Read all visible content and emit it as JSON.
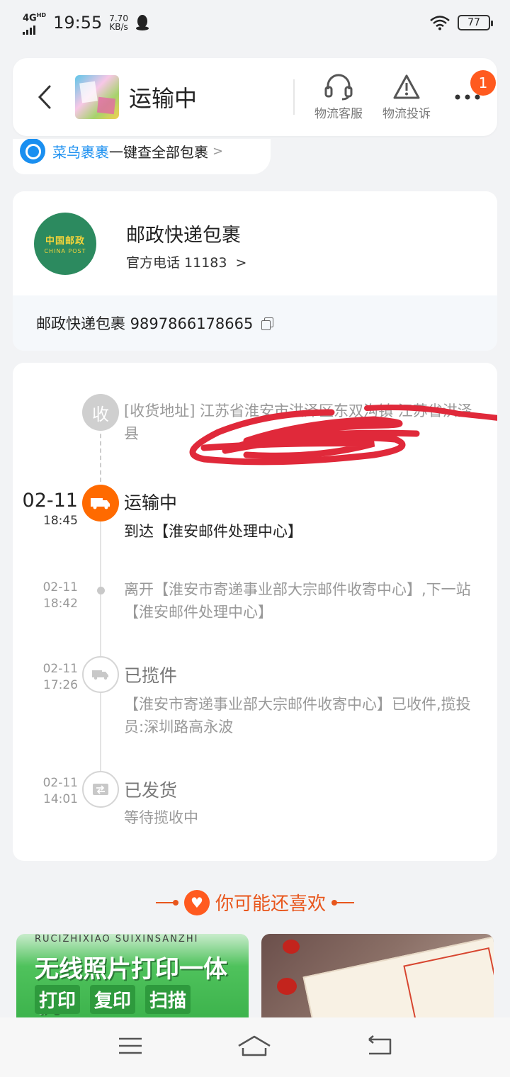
{
  "status_bar": {
    "network": "4G",
    "network_sup": "HD",
    "time": "19:55",
    "speed_value": "7.70",
    "speed_unit": "KB/s",
    "battery": "77"
  },
  "header": {
    "title": "运输中",
    "customer_service_label": "物流客服",
    "complaint_label": "物流投诉",
    "notification_count": "1"
  },
  "cainiao_strip": {
    "brand": "菜鸟裹裹",
    "text": "一键查全部包裹",
    "chevron": ">"
  },
  "carrier": {
    "logo_cn": "中国邮政",
    "logo_en": "CHINA POST",
    "name": "邮政快递包裹",
    "phone_label": "官方电话 11183",
    "phone_chevron": ">",
    "tracking_label": "邮政快递包裹 9897866178665"
  },
  "timeline": {
    "address_node_label": "收",
    "address_text": "[收货地址] 江苏省淮安市洪泽区东双沟镇 江苏省洪泽县",
    "events": [
      {
        "date": "02-11",
        "time": "18:45",
        "status": "运输中",
        "text": "到达【淮安邮件处理中心】"
      },
      {
        "date": "02-11",
        "time": "18:42",
        "status": "",
        "text": "离开【淮安市寄递事业部大宗邮件收寄中心】,下一站【淮安邮件处理中心】"
      },
      {
        "date": "02-11",
        "time": "17:26",
        "status": "已揽件",
        "text": "【淮安市寄递事业部大宗邮件收寄中心】已收件,揽投员:深圳路高永波"
      },
      {
        "date": "02-11",
        "time": "14:01",
        "status": "已发货",
        "text": "等待揽收中"
      }
    ]
  },
  "recommendations": {
    "title": "你可能还喜欢",
    "products": [
      {
        "subtitle": "RUCIZHIXIAO SUIXINSANZHI",
        "title": "无线照片打印一体机",
        "tags": [
          "打印",
          "复印",
          "扫描"
        ]
      },
      {
        "title": ""
      }
    ]
  },
  "icons": {
    "back": "chevron-left-icon",
    "customer_service": "headset-icon",
    "complaint": "warning-icon",
    "more": "more-dots-icon",
    "copy": "copy-icon",
    "nav_menu": "menu-icon",
    "nav_home": "home-icon",
    "nav_back": "back-icon"
  },
  "colors": {
    "accent_orange": "#ff6a00",
    "badge_red": "#ff5a1f",
    "china_post_green": "#2c8a5f",
    "cainiao_blue": "#1a8ff0",
    "scribble_red": "#e0293a"
  }
}
